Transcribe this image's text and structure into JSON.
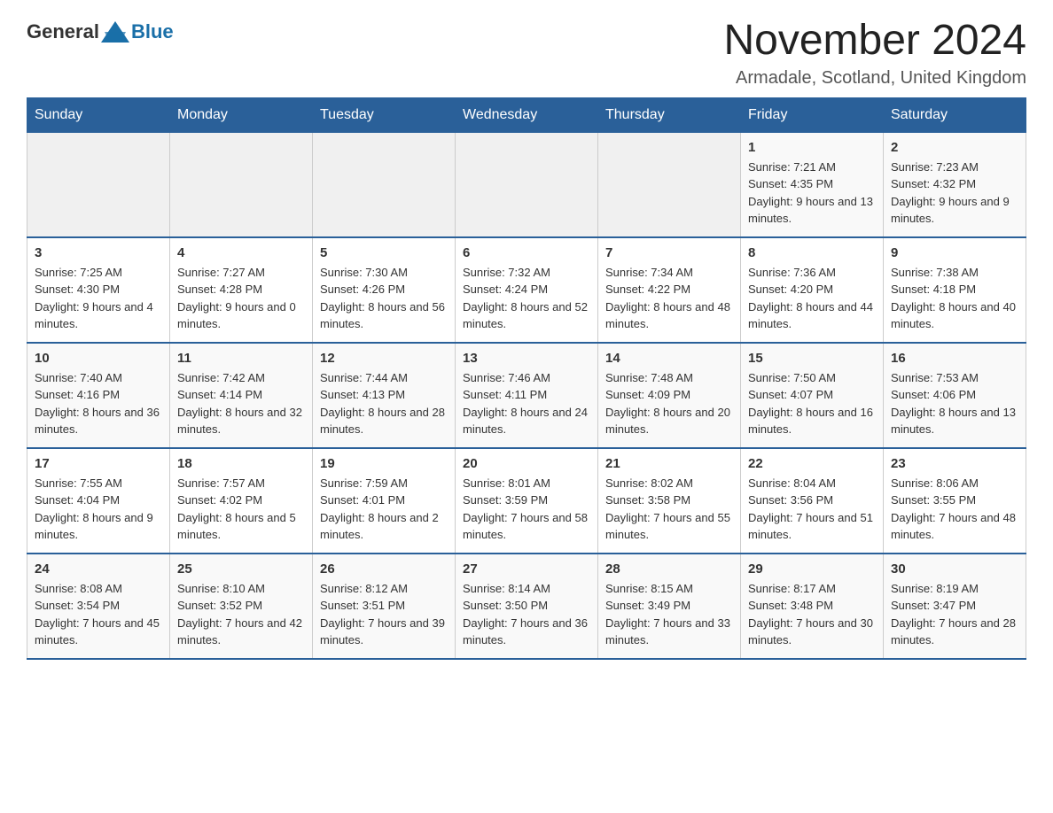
{
  "header": {
    "logo_general": "General",
    "logo_blue": "Blue",
    "month_title": "November 2024",
    "location": "Armadale, Scotland, United Kingdom"
  },
  "days_of_week": [
    "Sunday",
    "Monday",
    "Tuesday",
    "Wednesday",
    "Thursday",
    "Friday",
    "Saturday"
  ],
  "weeks": [
    [
      {
        "day": "",
        "info": ""
      },
      {
        "day": "",
        "info": ""
      },
      {
        "day": "",
        "info": ""
      },
      {
        "day": "",
        "info": ""
      },
      {
        "day": "",
        "info": ""
      },
      {
        "day": "1",
        "info": "Sunrise: 7:21 AM\nSunset: 4:35 PM\nDaylight: 9 hours and 13 minutes."
      },
      {
        "day": "2",
        "info": "Sunrise: 7:23 AM\nSunset: 4:32 PM\nDaylight: 9 hours and 9 minutes."
      }
    ],
    [
      {
        "day": "3",
        "info": "Sunrise: 7:25 AM\nSunset: 4:30 PM\nDaylight: 9 hours and 4 minutes."
      },
      {
        "day": "4",
        "info": "Sunrise: 7:27 AM\nSunset: 4:28 PM\nDaylight: 9 hours and 0 minutes."
      },
      {
        "day": "5",
        "info": "Sunrise: 7:30 AM\nSunset: 4:26 PM\nDaylight: 8 hours and 56 minutes."
      },
      {
        "day": "6",
        "info": "Sunrise: 7:32 AM\nSunset: 4:24 PM\nDaylight: 8 hours and 52 minutes."
      },
      {
        "day": "7",
        "info": "Sunrise: 7:34 AM\nSunset: 4:22 PM\nDaylight: 8 hours and 48 minutes."
      },
      {
        "day": "8",
        "info": "Sunrise: 7:36 AM\nSunset: 4:20 PM\nDaylight: 8 hours and 44 minutes."
      },
      {
        "day": "9",
        "info": "Sunrise: 7:38 AM\nSunset: 4:18 PM\nDaylight: 8 hours and 40 minutes."
      }
    ],
    [
      {
        "day": "10",
        "info": "Sunrise: 7:40 AM\nSunset: 4:16 PM\nDaylight: 8 hours and 36 minutes."
      },
      {
        "day": "11",
        "info": "Sunrise: 7:42 AM\nSunset: 4:14 PM\nDaylight: 8 hours and 32 minutes."
      },
      {
        "day": "12",
        "info": "Sunrise: 7:44 AM\nSunset: 4:13 PM\nDaylight: 8 hours and 28 minutes."
      },
      {
        "day": "13",
        "info": "Sunrise: 7:46 AM\nSunset: 4:11 PM\nDaylight: 8 hours and 24 minutes."
      },
      {
        "day": "14",
        "info": "Sunrise: 7:48 AM\nSunset: 4:09 PM\nDaylight: 8 hours and 20 minutes."
      },
      {
        "day": "15",
        "info": "Sunrise: 7:50 AM\nSunset: 4:07 PM\nDaylight: 8 hours and 16 minutes."
      },
      {
        "day": "16",
        "info": "Sunrise: 7:53 AM\nSunset: 4:06 PM\nDaylight: 8 hours and 13 minutes."
      }
    ],
    [
      {
        "day": "17",
        "info": "Sunrise: 7:55 AM\nSunset: 4:04 PM\nDaylight: 8 hours and 9 minutes."
      },
      {
        "day": "18",
        "info": "Sunrise: 7:57 AM\nSunset: 4:02 PM\nDaylight: 8 hours and 5 minutes."
      },
      {
        "day": "19",
        "info": "Sunrise: 7:59 AM\nSunset: 4:01 PM\nDaylight: 8 hours and 2 minutes."
      },
      {
        "day": "20",
        "info": "Sunrise: 8:01 AM\nSunset: 3:59 PM\nDaylight: 7 hours and 58 minutes."
      },
      {
        "day": "21",
        "info": "Sunrise: 8:02 AM\nSunset: 3:58 PM\nDaylight: 7 hours and 55 minutes."
      },
      {
        "day": "22",
        "info": "Sunrise: 8:04 AM\nSunset: 3:56 PM\nDaylight: 7 hours and 51 minutes."
      },
      {
        "day": "23",
        "info": "Sunrise: 8:06 AM\nSunset: 3:55 PM\nDaylight: 7 hours and 48 minutes."
      }
    ],
    [
      {
        "day": "24",
        "info": "Sunrise: 8:08 AM\nSunset: 3:54 PM\nDaylight: 7 hours and 45 minutes."
      },
      {
        "day": "25",
        "info": "Sunrise: 8:10 AM\nSunset: 3:52 PM\nDaylight: 7 hours and 42 minutes."
      },
      {
        "day": "26",
        "info": "Sunrise: 8:12 AM\nSunset: 3:51 PM\nDaylight: 7 hours and 39 minutes."
      },
      {
        "day": "27",
        "info": "Sunrise: 8:14 AM\nSunset: 3:50 PM\nDaylight: 7 hours and 36 minutes."
      },
      {
        "day": "28",
        "info": "Sunrise: 8:15 AM\nSunset: 3:49 PM\nDaylight: 7 hours and 33 minutes."
      },
      {
        "day": "29",
        "info": "Sunrise: 8:17 AM\nSunset: 3:48 PM\nDaylight: 7 hours and 30 minutes."
      },
      {
        "day": "30",
        "info": "Sunrise: 8:19 AM\nSunset: 3:47 PM\nDaylight: 7 hours and 28 minutes."
      }
    ]
  ]
}
